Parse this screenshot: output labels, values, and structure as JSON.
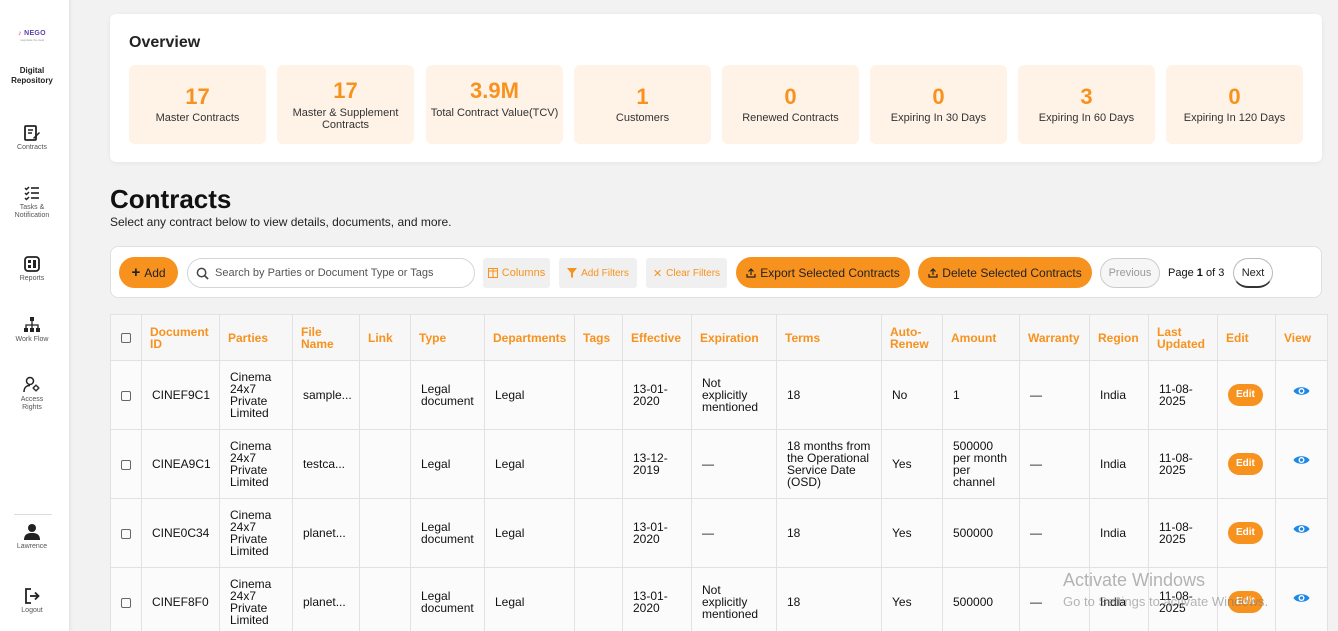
{
  "sidebar": {
    "logo_text": "NEGO",
    "logo_tagline": "negotiate the deal",
    "brand_line1": "Digital",
    "brand_line2": "Repository",
    "items": [
      {
        "label": "Contracts",
        "icon": "contract-edit-icon"
      },
      {
        "label_line1": "Tasks &",
        "label_line2": "Notification",
        "icon": "task-list-icon"
      },
      {
        "label": "Reports",
        "icon": "reports-icon"
      },
      {
        "label": "Work Flow",
        "icon": "workflow-icon"
      },
      {
        "label_line1": "Access",
        "label_line2": "Rights",
        "icon": "access-rights-icon"
      }
    ],
    "user": {
      "label": "Lawrence",
      "icon": "user-icon"
    },
    "logout": {
      "label": "Logout",
      "icon": "logout-icon"
    }
  },
  "overview": {
    "title": "Overview",
    "stats": [
      {
        "value": "17",
        "label": "Master Contracts"
      },
      {
        "value": "17",
        "label": "Master & Supplement Contracts"
      },
      {
        "value": "3.9M",
        "label": "Total Contract Value(TCV)"
      },
      {
        "value": "1",
        "label": "Customers"
      },
      {
        "value": "0",
        "label": "Renewed Contracts"
      },
      {
        "value": "0",
        "label": "Expiring In 30 Days"
      },
      {
        "value": "3",
        "label": "Expiring In 60 Days"
      },
      {
        "value": "0",
        "label": "Expiring In 120 Days"
      }
    ]
  },
  "contracts": {
    "title": "Contracts",
    "subtitle": "Select any contract below to view details, documents, and more."
  },
  "toolbar": {
    "add_label": "Add",
    "search_placeholder": "Search by Parties or Document Type or Tags",
    "columns_label": "Columns",
    "add_filters_label": "Add Filters",
    "clear_filters_label": "Clear Filters",
    "export_label": "Export Selected Contracts",
    "delete_label": "Delete Selected Contracts",
    "previous_label": "Previous",
    "page_prefix": "Page",
    "page_current": "1",
    "page_of": "of",
    "page_total": "3",
    "next_label": "Next"
  },
  "table": {
    "headers": [
      "Document ID",
      "Parties",
      "File Name",
      "Link",
      "Type",
      "Departments",
      "Tags",
      "Effective",
      "Expiration",
      "Terms",
      "Auto-Renew",
      "Amount",
      "Warranty",
      "Region",
      "Last Updated",
      "Edit",
      "View"
    ],
    "edit_label": "Edit",
    "rows": [
      {
        "id": "CINEF9C1",
        "parties": "Cinema 24x7 Private Limited",
        "file": "sample...",
        "link": "",
        "type": "Legal document",
        "dept": "Legal",
        "tags": "",
        "effective": "13-01-2020",
        "expiration": "Not explicitly mentioned",
        "terms": "18",
        "auto": "No",
        "amount": "1",
        "warranty": "—",
        "region": "India",
        "updated": "11-08-2025"
      },
      {
        "id": "CINEA9C1",
        "parties": "Cinema 24x7 Private Limited",
        "file": "testca...",
        "link": "",
        "type": "Legal",
        "dept": "Legal",
        "tags": "",
        "effective": "13-12-2019",
        "expiration": "—",
        "terms": "18 months from the Operational Service Date (OSD)",
        "auto": "Yes",
        "amount": "500000 per month per channel",
        "warranty": "—",
        "region": "India",
        "updated": "11-08-2025"
      },
      {
        "id": "CINE0C34",
        "parties": "Cinema 24x7 Private Limited",
        "file": "planet...",
        "link": "",
        "type": "Legal document",
        "dept": "Legal",
        "tags": "",
        "effective": "13-01-2020",
        "expiration": "—",
        "terms": "18",
        "auto": "Yes",
        "amount": "500000",
        "warranty": "—",
        "region": "India",
        "updated": "11-08-2025"
      },
      {
        "id": "CINEF8F0",
        "parties": "Cinema 24x7 Private Limited",
        "file": "planet...",
        "link": "",
        "type": "Legal document",
        "dept": "Legal",
        "tags": "",
        "effective": "13-01-2020",
        "expiration": "Not explicitly mentioned",
        "terms": "18",
        "auto": "Yes",
        "amount": "500000",
        "warranty": "—",
        "region": "India",
        "updated": "11-08-2025"
      }
    ]
  },
  "watermark": {
    "line1": "Activate Windows",
    "line2": "Go to Settings to activate Windows."
  },
  "colors": {
    "accent": "#f7921e",
    "stat_bg": "#fff3e8",
    "view_icon": "#1e88e5"
  }
}
